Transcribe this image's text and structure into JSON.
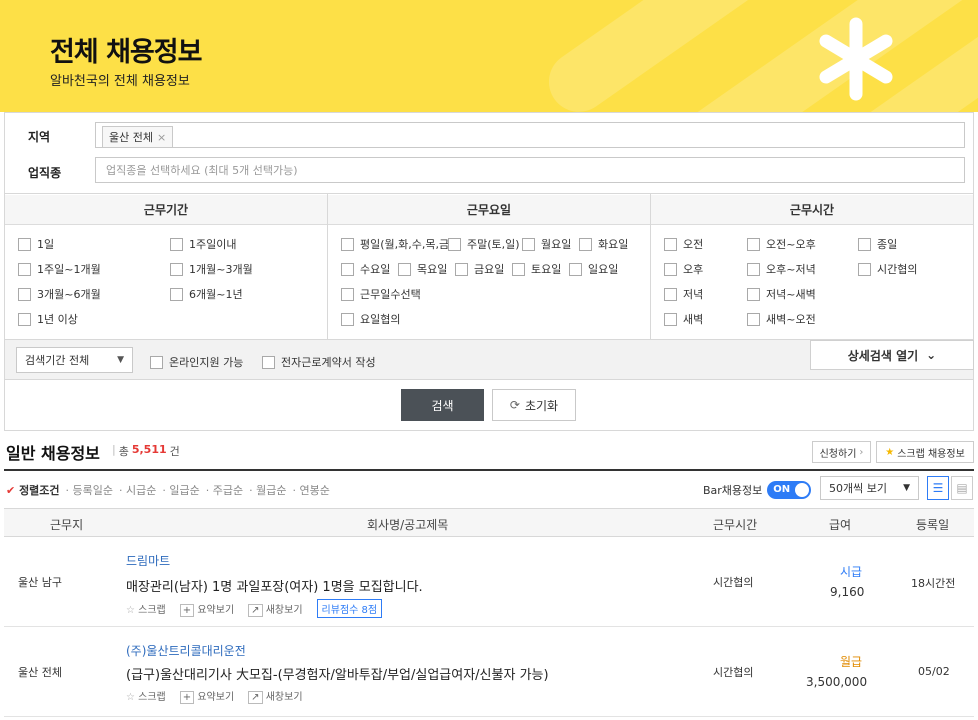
{
  "banner": {
    "title": "전체 채용정보",
    "subtitle": "알바천국의 전체 채용정보",
    "bg_color": "#fde047"
  },
  "filters": {
    "region_label": "지역",
    "region_chip": "울산 전체",
    "job_label": "업직종",
    "job_placeholder": "업직종을 선택하세요 (최대 5개 선택가능)"
  },
  "period": {
    "header": "근무기간",
    "options": [
      "1일",
      "1주일이내",
      "1주일~1개월",
      "1개월~3개월",
      "3개월~6개월",
      "6개월~1년",
      "1년 이상"
    ]
  },
  "days": {
    "header": "근무요일",
    "options": [
      "평일(월,화,수,목,금)",
      "주말(토,일)",
      "월요일",
      "화요일",
      "수요일",
      "목요일",
      "금요일",
      "토요일",
      "일요일",
      "근무일수선택",
      "요일협의"
    ]
  },
  "times": {
    "header": "근무시간",
    "options": [
      "오전",
      "오전~오후",
      "종일",
      "오후",
      "오후~저녁",
      "시간협의",
      "저녁",
      "저녁~새벽",
      "새벽",
      "새벽~오전"
    ]
  },
  "search_period": "검색기간 전체",
  "online_support": "온라인지원 가능",
  "e_contract": "전자근로계약서 작성",
  "detail_search": "상세검색 열기",
  "search_button": "검색",
  "reset_button": "초기화",
  "listing": {
    "title": "일반 채용정보",
    "total_prefix": "총",
    "total_count": "5,511",
    "total_suffix": "건",
    "apply_button": "신청하기",
    "scrap_button": "스크랩 채용정보",
    "sort_label": "정렬조건",
    "sorts": [
      "등록일순",
      "시급순",
      "일급순",
      "주급순",
      "월급순",
      "연봉순"
    ],
    "bar_label": "Bar채용정보",
    "toggle_label": "ON",
    "per_page": "50개씩 보기",
    "accent": "#2e7cf6"
  },
  "columns": [
    "근무지",
    "회사명/공고제목",
    "근무시간",
    "급여",
    "등록일"
  ],
  "jobs": [
    {
      "location": "울산 남구",
      "company": "드림마트",
      "title": "매장관리(남자) 1명 과일포장(여자) 1명을 모집합니다.",
      "scrap": "스크랩",
      "summary": "요약보기",
      "new_window": "새창보기",
      "review": "리뷰점수 8점",
      "time": "시간협의",
      "pay_type": "시급",
      "pay": "9,160",
      "date": "18시간전"
    },
    {
      "location": "울산 전체",
      "company": "(주)울산트리콜대리운전",
      "title": "(급구)울산대리기사 大모집-(무경험자/알바투잡/부업/실업급여자/신불자 가능)",
      "scrap": "스크랩",
      "summary": "요약보기",
      "new_window": "새창보기",
      "time": "시간협의",
      "pay_type": "월급",
      "pay": "3,500,000",
      "date": "05/02"
    }
  ]
}
